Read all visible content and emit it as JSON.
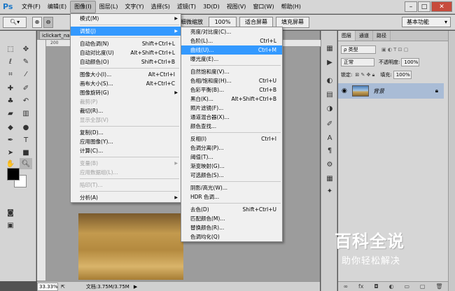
{
  "app": {
    "logo": "Ps"
  },
  "menubar": {
    "items": [
      "文件(F)",
      "编辑(E)",
      "图像(I)",
      "图层(L)",
      "文字(Y)",
      "选择(S)",
      "滤镜(T)",
      "3D(D)",
      "视图(V)",
      "窗口(W)",
      "帮助(H)"
    ],
    "active_index": 2
  },
  "window_controls": {
    "minimize": "–",
    "maximize": "□",
    "close": "✕"
  },
  "optbar": {
    "scrubby_zoom_label": "细微缩放",
    "zoom_value": "100%",
    "fit_screen": "适合屏幕",
    "fill_screen": "填充屏幕",
    "workspace": "基本功能"
  },
  "document": {
    "tab_title": "iclickart_nat",
    "ruler_mark": "200",
    "zoom": "33.33%",
    "doc_info": "文档:3.75M/3.75M"
  },
  "image_menu": {
    "items": [
      {
        "label": "模式(M)",
        "submenu": true
      },
      {
        "sep": true
      },
      {
        "label": "调整(J)",
        "submenu": true,
        "highlight": true
      },
      {
        "sep": true
      },
      {
        "label": "自动色调(N)",
        "shortcut": "Shift+Ctrl+L"
      },
      {
        "label": "自动对比度(U)",
        "shortcut": "Alt+Shift+Ctrl+L"
      },
      {
        "label": "自动颜色(O)",
        "shortcut": "Shift+Ctrl+B"
      },
      {
        "sep": true
      },
      {
        "label": "图像大小(I)...",
        "shortcut": "Alt+Ctrl+I"
      },
      {
        "label": "画布大小(S)...",
        "shortcut": "Alt+Ctrl+C"
      },
      {
        "label": "图像旋转(G)",
        "submenu": true
      },
      {
        "label": "裁剪(P)",
        "disabled": true
      },
      {
        "label": "裁切(R)..."
      },
      {
        "label": "显示全部(V)",
        "disabled": true
      },
      {
        "sep": true
      },
      {
        "label": "复制(D)..."
      },
      {
        "label": "应用图像(Y)..."
      },
      {
        "label": "计算(C)..."
      },
      {
        "sep": true
      },
      {
        "label": "变量(B)",
        "submenu": true,
        "disabled": true
      },
      {
        "label": "应用数据组(L)...",
        "disabled": true
      },
      {
        "sep": true
      },
      {
        "label": "陷印(T)...",
        "disabled": true
      },
      {
        "sep": true
      },
      {
        "label": "分析(A)",
        "submenu": true
      }
    ]
  },
  "adjust_menu": {
    "items": [
      {
        "label": "亮度/对比度(C)..."
      },
      {
        "label": "色阶(L)...",
        "shortcut": "Ctrl+L"
      },
      {
        "label": "曲线(U)...",
        "shortcut": "Ctrl+M",
        "highlight": true
      },
      {
        "label": "曝光度(E)..."
      },
      {
        "sep": true
      },
      {
        "label": "自然饱和度(V)..."
      },
      {
        "label": "色相/饱和度(H)...",
        "shortcut": "Ctrl+U"
      },
      {
        "label": "色彩平衡(B)...",
        "shortcut": "Ctrl+B"
      },
      {
        "label": "黑白(K)...",
        "shortcut": "Alt+Shift+Ctrl+B"
      },
      {
        "label": "照片滤镜(F)..."
      },
      {
        "label": "通道混合器(X)..."
      },
      {
        "label": "颜色查找..."
      },
      {
        "sep": true
      },
      {
        "label": "反相(I)",
        "shortcut": "Ctrl+I"
      },
      {
        "label": "色调分离(P)..."
      },
      {
        "label": "阈值(T)..."
      },
      {
        "label": "渐变映射(G)..."
      },
      {
        "label": "可选颜色(S)..."
      },
      {
        "sep": true
      },
      {
        "label": "阴影/高光(W)..."
      },
      {
        "label": "HDR 色调..."
      },
      {
        "sep": true
      },
      {
        "label": "去色(D)",
        "shortcut": "Shift+Ctrl+U"
      },
      {
        "label": "匹配颜色(M)..."
      },
      {
        "label": "替换颜色(R)..."
      },
      {
        "label": "色调均化(Q)"
      }
    ]
  },
  "layers_panel": {
    "tabs": [
      "图层",
      "通道",
      "路径"
    ],
    "kind_filter": "ρ 类型",
    "blend_mode": "正常",
    "opacity_label": "不透明度:",
    "opacity_value": "100%",
    "lock_label": "锁定:",
    "fill_label": "填充:",
    "fill_value": "100%",
    "layer_name": "背景"
  },
  "watermark": {
    "title": "百科全说",
    "subtitle": "助你轻松解决"
  },
  "colors": {
    "highlight": "#3399ff",
    "layer_selected": "#a9bcd6"
  }
}
